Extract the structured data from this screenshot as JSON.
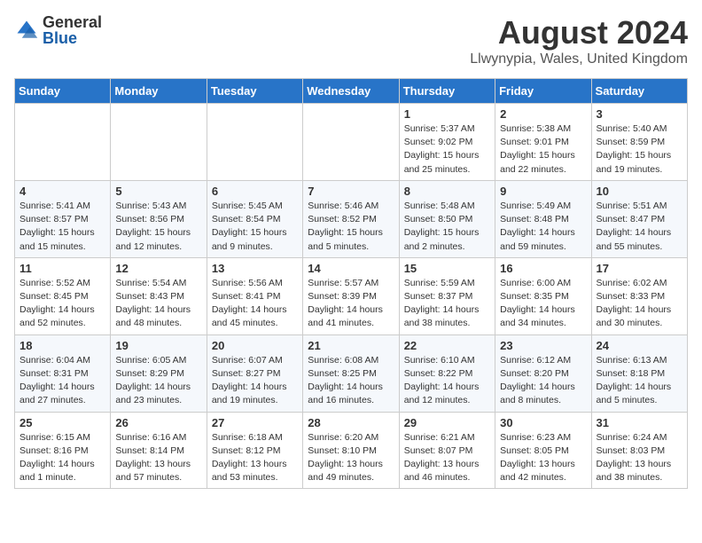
{
  "logo": {
    "text_general": "General",
    "text_blue": "Blue"
  },
  "header": {
    "month": "August 2024",
    "location": "Llwynypia, Wales, United Kingdom"
  },
  "weekdays": [
    "Sunday",
    "Monday",
    "Tuesday",
    "Wednesday",
    "Thursday",
    "Friday",
    "Saturday"
  ],
  "weeks": [
    [
      {
        "day": "",
        "info": ""
      },
      {
        "day": "",
        "info": ""
      },
      {
        "day": "",
        "info": ""
      },
      {
        "day": "",
        "info": ""
      },
      {
        "day": "1",
        "info": "Sunrise: 5:37 AM\nSunset: 9:02 PM\nDaylight: 15 hours\nand 25 minutes."
      },
      {
        "day": "2",
        "info": "Sunrise: 5:38 AM\nSunset: 9:01 PM\nDaylight: 15 hours\nand 22 minutes."
      },
      {
        "day": "3",
        "info": "Sunrise: 5:40 AM\nSunset: 8:59 PM\nDaylight: 15 hours\nand 19 minutes."
      }
    ],
    [
      {
        "day": "4",
        "info": "Sunrise: 5:41 AM\nSunset: 8:57 PM\nDaylight: 15 hours\nand 15 minutes."
      },
      {
        "day": "5",
        "info": "Sunrise: 5:43 AM\nSunset: 8:56 PM\nDaylight: 15 hours\nand 12 minutes."
      },
      {
        "day": "6",
        "info": "Sunrise: 5:45 AM\nSunset: 8:54 PM\nDaylight: 15 hours\nand 9 minutes."
      },
      {
        "day": "7",
        "info": "Sunrise: 5:46 AM\nSunset: 8:52 PM\nDaylight: 15 hours\nand 5 minutes."
      },
      {
        "day": "8",
        "info": "Sunrise: 5:48 AM\nSunset: 8:50 PM\nDaylight: 15 hours\nand 2 minutes."
      },
      {
        "day": "9",
        "info": "Sunrise: 5:49 AM\nSunset: 8:48 PM\nDaylight: 14 hours\nand 59 minutes."
      },
      {
        "day": "10",
        "info": "Sunrise: 5:51 AM\nSunset: 8:47 PM\nDaylight: 14 hours\nand 55 minutes."
      }
    ],
    [
      {
        "day": "11",
        "info": "Sunrise: 5:52 AM\nSunset: 8:45 PM\nDaylight: 14 hours\nand 52 minutes."
      },
      {
        "day": "12",
        "info": "Sunrise: 5:54 AM\nSunset: 8:43 PM\nDaylight: 14 hours\nand 48 minutes."
      },
      {
        "day": "13",
        "info": "Sunrise: 5:56 AM\nSunset: 8:41 PM\nDaylight: 14 hours\nand 45 minutes."
      },
      {
        "day": "14",
        "info": "Sunrise: 5:57 AM\nSunset: 8:39 PM\nDaylight: 14 hours\nand 41 minutes."
      },
      {
        "day": "15",
        "info": "Sunrise: 5:59 AM\nSunset: 8:37 PM\nDaylight: 14 hours\nand 38 minutes."
      },
      {
        "day": "16",
        "info": "Sunrise: 6:00 AM\nSunset: 8:35 PM\nDaylight: 14 hours\nand 34 minutes."
      },
      {
        "day": "17",
        "info": "Sunrise: 6:02 AM\nSunset: 8:33 PM\nDaylight: 14 hours\nand 30 minutes."
      }
    ],
    [
      {
        "day": "18",
        "info": "Sunrise: 6:04 AM\nSunset: 8:31 PM\nDaylight: 14 hours\nand 27 minutes."
      },
      {
        "day": "19",
        "info": "Sunrise: 6:05 AM\nSunset: 8:29 PM\nDaylight: 14 hours\nand 23 minutes."
      },
      {
        "day": "20",
        "info": "Sunrise: 6:07 AM\nSunset: 8:27 PM\nDaylight: 14 hours\nand 19 minutes."
      },
      {
        "day": "21",
        "info": "Sunrise: 6:08 AM\nSunset: 8:25 PM\nDaylight: 14 hours\nand 16 minutes."
      },
      {
        "day": "22",
        "info": "Sunrise: 6:10 AM\nSunset: 8:22 PM\nDaylight: 14 hours\nand 12 minutes."
      },
      {
        "day": "23",
        "info": "Sunrise: 6:12 AM\nSunset: 8:20 PM\nDaylight: 14 hours\nand 8 minutes."
      },
      {
        "day": "24",
        "info": "Sunrise: 6:13 AM\nSunset: 8:18 PM\nDaylight: 14 hours\nand 5 minutes."
      }
    ],
    [
      {
        "day": "25",
        "info": "Sunrise: 6:15 AM\nSunset: 8:16 PM\nDaylight: 14 hours\nand 1 minute."
      },
      {
        "day": "26",
        "info": "Sunrise: 6:16 AM\nSunset: 8:14 PM\nDaylight: 13 hours\nand 57 minutes."
      },
      {
        "day": "27",
        "info": "Sunrise: 6:18 AM\nSunset: 8:12 PM\nDaylight: 13 hours\nand 53 minutes."
      },
      {
        "day": "28",
        "info": "Sunrise: 6:20 AM\nSunset: 8:10 PM\nDaylight: 13 hours\nand 49 minutes."
      },
      {
        "day": "29",
        "info": "Sunrise: 6:21 AM\nSunset: 8:07 PM\nDaylight: 13 hours\nand 46 minutes."
      },
      {
        "day": "30",
        "info": "Sunrise: 6:23 AM\nSunset: 8:05 PM\nDaylight: 13 hours\nand 42 minutes."
      },
      {
        "day": "31",
        "info": "Sunrise: 6:24 AM\nSunset: 8:03 PM\nDaylight: 13 hours\nand 38 minutes."
      }
    ]
  ]
}
